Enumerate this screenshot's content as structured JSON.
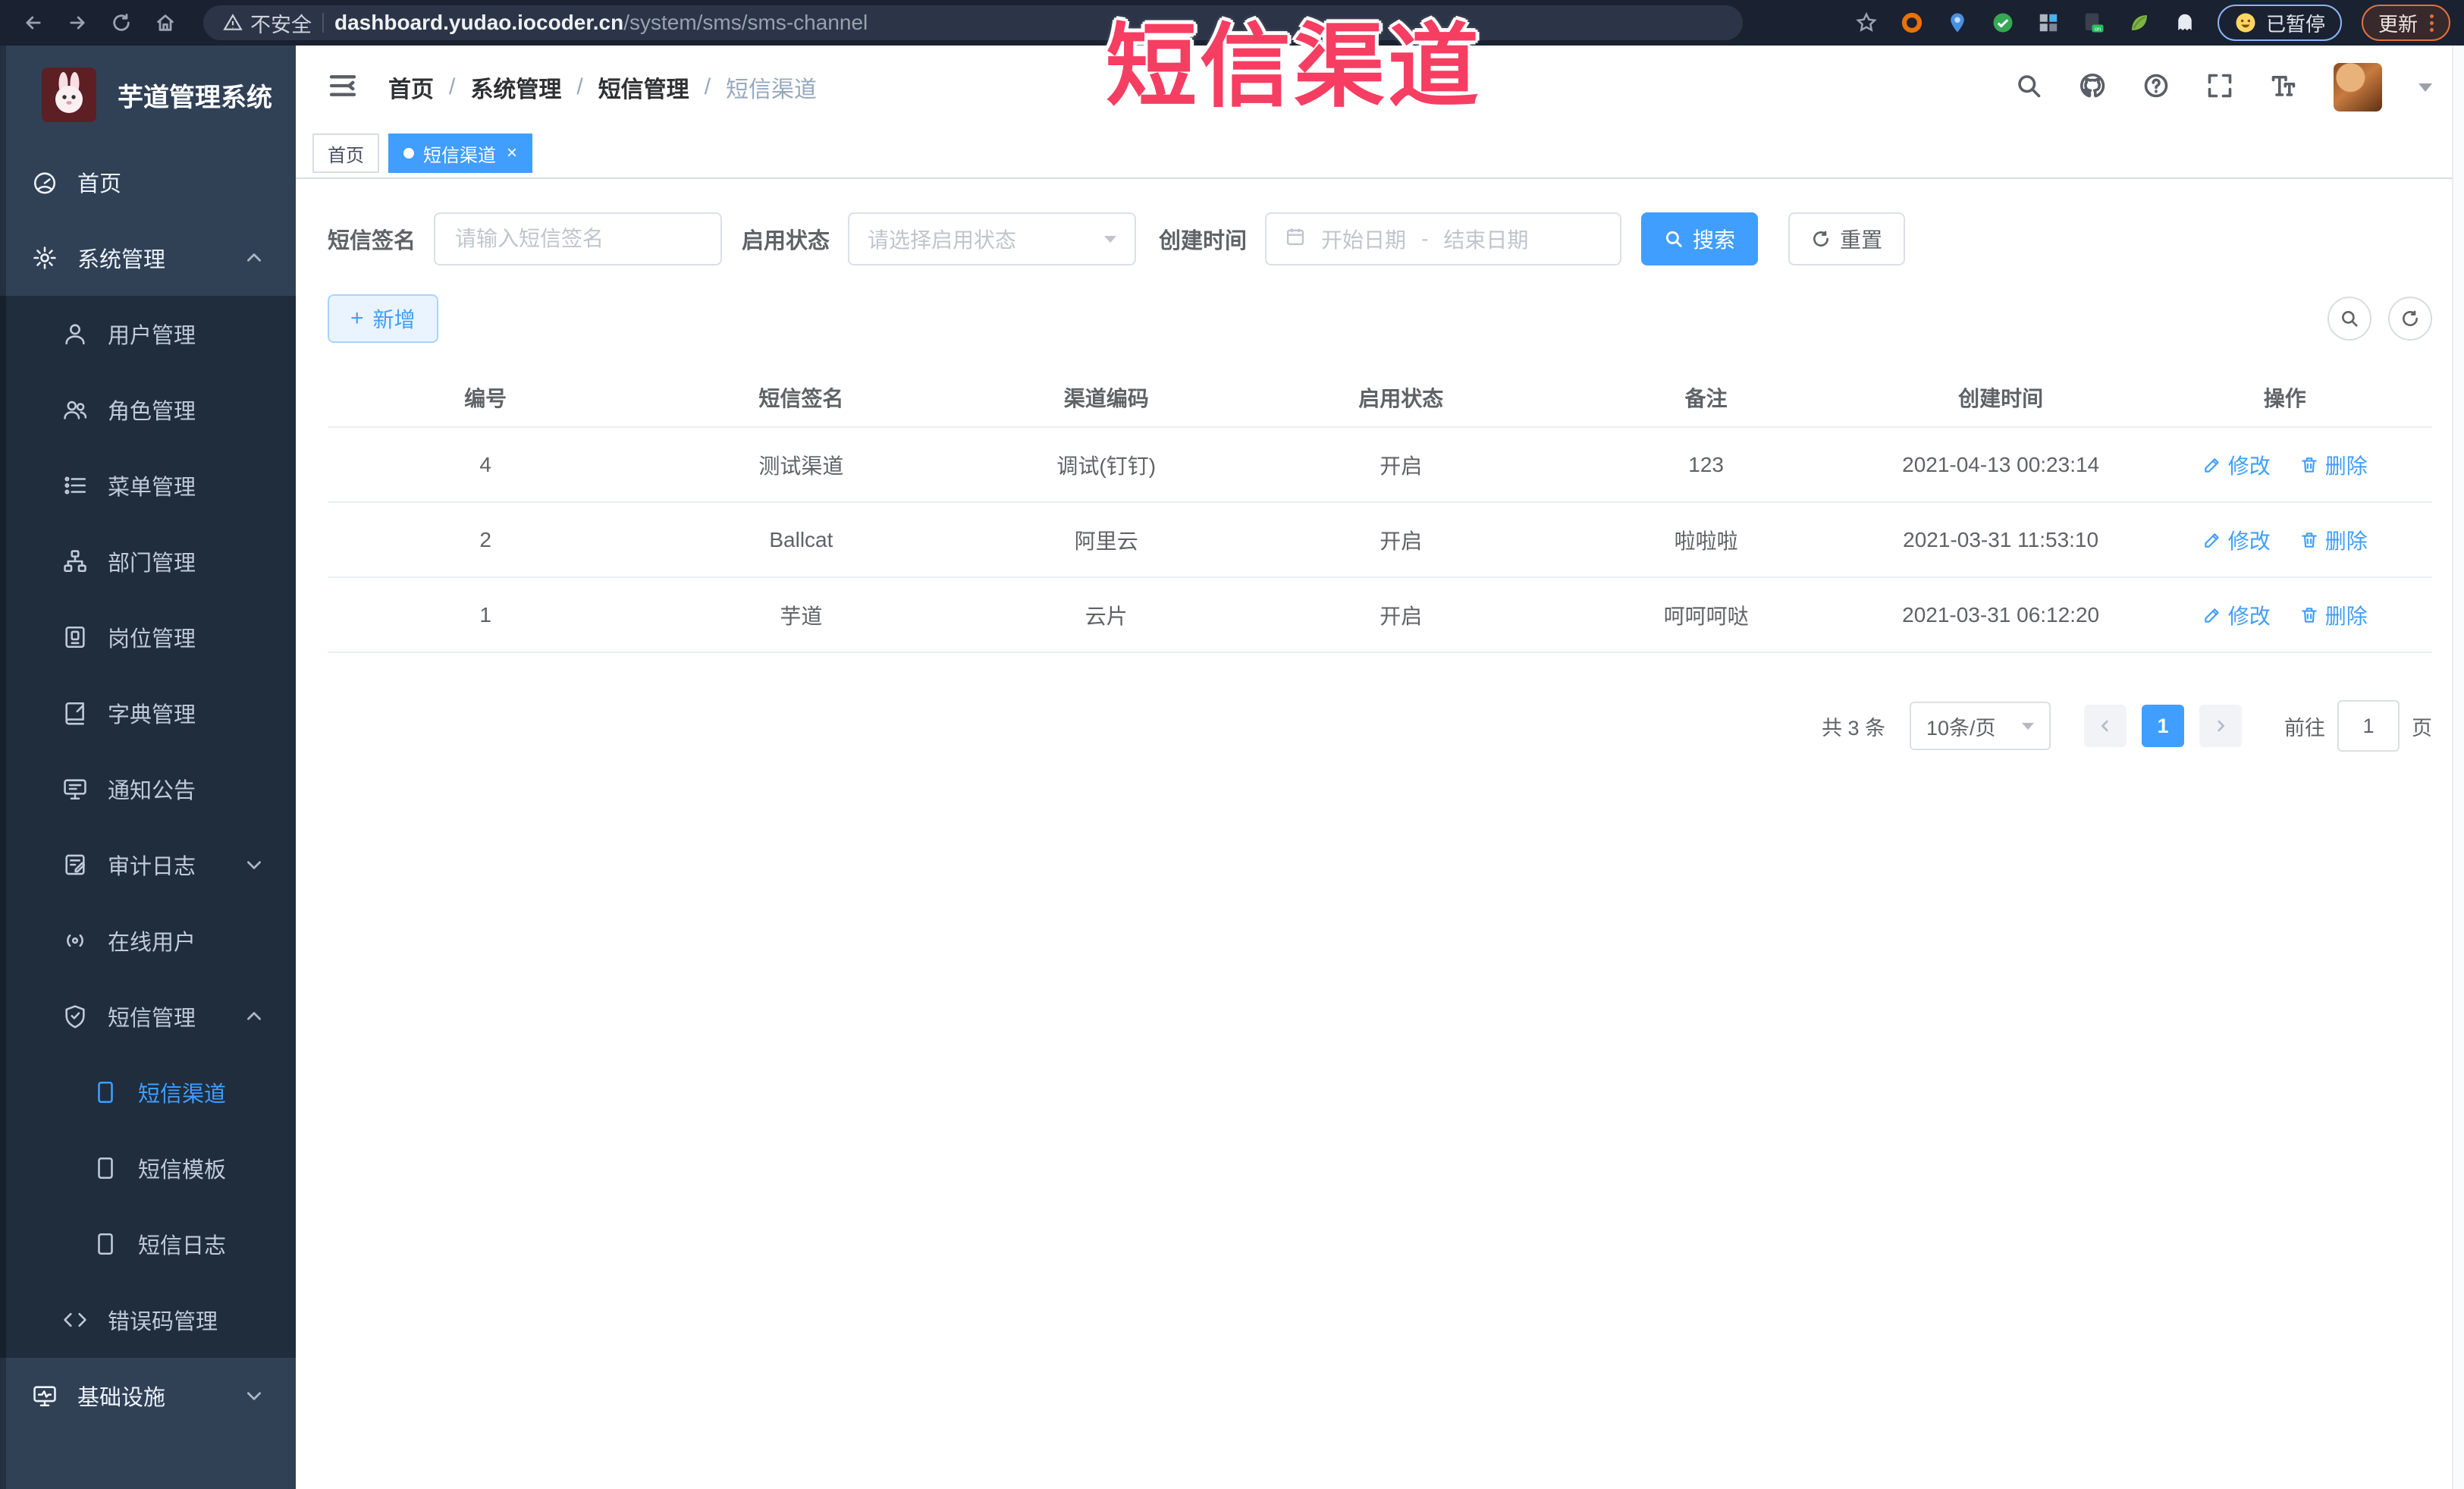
{
  "overlay": {
    "title": "短信渠道"
  },
  "browser": {
    "security_label": "不安全",
    "url_host": "dashboard.yudao.iocoder.cn",
    "url_path": "/system/sms/sms-channel",
    "paused_badge": "已暂停",
    "update_button": "更新"
  },
  "sidebar": {
    "app_title": "芋道管理系统",
    "items": [
      {
        "label": "首页"
      },
      {
        "label": "系统管理"
      },
      {
        "label": "用户管理"
      },
      {
        "label": "角色管理"
      },
      {
        "label": "菜单管理"
      },
      {
        "label": "部门管理"
      },
      {
        "label": "岗位管理"
      },
      {
        "label": "字典管理"
      },
      {
        "label": "通知公告"
      },
      {
        "label": "审计日志"
      },
      {
        "label": "在线用户"
      },
      {
        "label": "短信管理"
      },
      {
        "label": "短信渠道"
      },
      {
        "label": "短信模板"
      },
      {
        "label": "短信日志"
      },
      {
        "label": "错误码管理"
      },
      {
        "label": "基础设施"
      }
    ]
  },
  "breadcrumb": {
    "separator": "/",
    "items": [
      "首页",
      "系统管理",
      "短信管理",
      "短信渠道"
    ]
  },
  "tabs": [
    {
      "label": "首页"
    },
    {
      "label": "短信渠道"
    }
  ],
  "filters": {
    "sign_label": "短信签名",
    "sign_placeholder": "请输入短信签名",
    "status_label": "启用状态",
    "status_placeholder": "请选择启用状态",
    "time_label": "创建时间",
    "start_placeholder": "开始日期",
    "range_separator": "-",
    "end_placeholder": "结束日期",
    "search_button": "搜索",
    "reset_button": "重置"
  },
  "toolbar": {
    "add_button": "新增"
  },
  "table": {
    "columns": [
      "编号",
      "短信签名",
      "渠道编码",
      "启用状态",
      "备注",
      "创建时间",
      "操作"
    ],
    "edit_label": "修改",
    "delete_label": "删除",
    "rows": [
      {
        "id": "4",
        "sign": "测试渠道",
        "code": "调试(钉钉)",
        "status": "开启",
        "remark": "123",
        "created": "2021-04-13 00:23:14"
      },
      {
        "id": "2",
        "sign": "Ballcat",
        "code": "阿里云",
        "status": "开启",
        "remark": "啦啦啦",
        "created": "2021-03-31 11:53:10"
      },
      {
        "id": "1",
        "sign": "芋道",
        "code": "云片",
        "status": "开启",
        "remark": "呵呵呵哒",
        "created": "2021-03-31 06:12:20"
      }
    ]
  },
  "pagination": {
    "total": "共 3 条",
    "page_size": "10条/页",
    "current_page": "1",
    "goto_label": "前往",
    "goto_value": "1",
    "page_unit": "页"
  },
  "colors": {
    "accent": "#409eff",
    "sidebar_root_bg": "#304156",
    "sidebar_sub_bg": "#1f2d3d",
    "overlay_red": "#f53e62"
  }
}
